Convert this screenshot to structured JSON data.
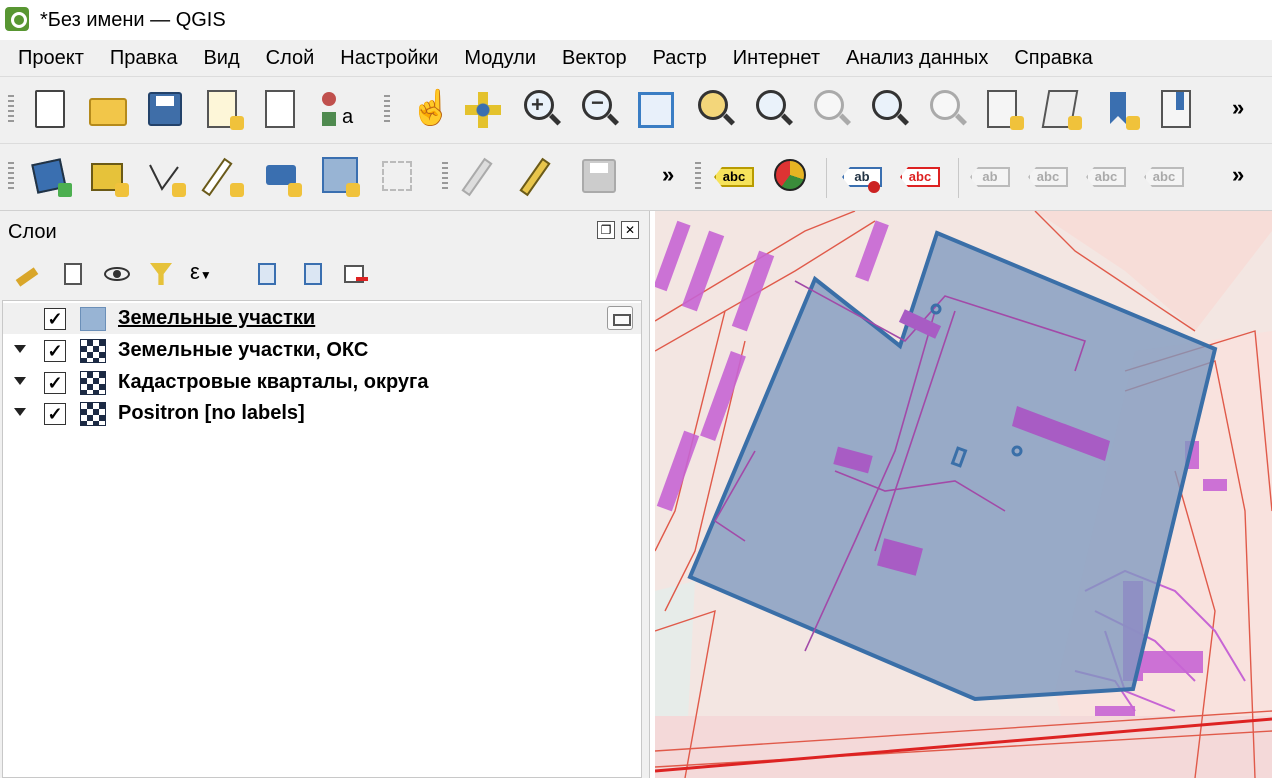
{
  "window": {
    "title": "*Без имени — QGIS"
  },
  "menu": [
    "Проект",
    "Правка",
    "Вид",
    "Слой",
    "Настройки",
    "Модули",
    "Вектор",
    "Растр",
    "Интернет",
    "Анализ данных",
    "Справка"
  ],
  "toolbar": {
    "row1": [
      "new-project",
      "open-project",
      "save-project",
      "new-print-layout",
      "layout-manager",
      "style-manager",
      "pan",
      "pan-to-selection",
      "zoom-in",
      "zoom-out",
      "zoom-full",
      "zoom-to-selection",
      "zoom-to-layer",
      "zoom-native",
      "zoom-last",
      "zoom-next",
      "new-map-view",
      "new-3d-view",
      "new-bookmark",
      "show-bookmarks"
    ],
    "row2": [
      "data-source-manager",
      "new-geopackage-layer",
      "new-shapefile-layer",
      "new-temp-layer",
      "new-virtual-layer",
      "new-spatialite-layer",
      "digitize",
      "toggle-editing",
      "save-edits",
      "labels",
      "diagrams",
      "layer-labeling",
      "highlight-pinned-labels",
      "pin-unpin-labels",
      "show-hide-labels",
      "move-label",
      "rotate-label"
    ],
    "overflow": "»",
    "labels_abc": "abc",
    "labels_ab": "ab"
  },
  "layers_panel": {
    "title": "Слои",
    "layers": [
      {
        "name": "Земельные участки",
        "checked": "✓",
        "selected": true
      },
      {
        "name": "Земельные участки, ОКС",
        "checked": "✓"
      },
      {
        "name": "Кадастровые кварталы, округа",
        "checked": "✓"
      },
      {
        "name": "Positron [no labels]",
        "checked": "✓"
      }
    ]
  },
  "colors": {
    "parcel_fill": "#7d99bf",
    "parcel_stroke": "#3a6fa8",
    "buildings": "#c765d4",
    "quarter_lines": "#e05a4a"
  }
}
